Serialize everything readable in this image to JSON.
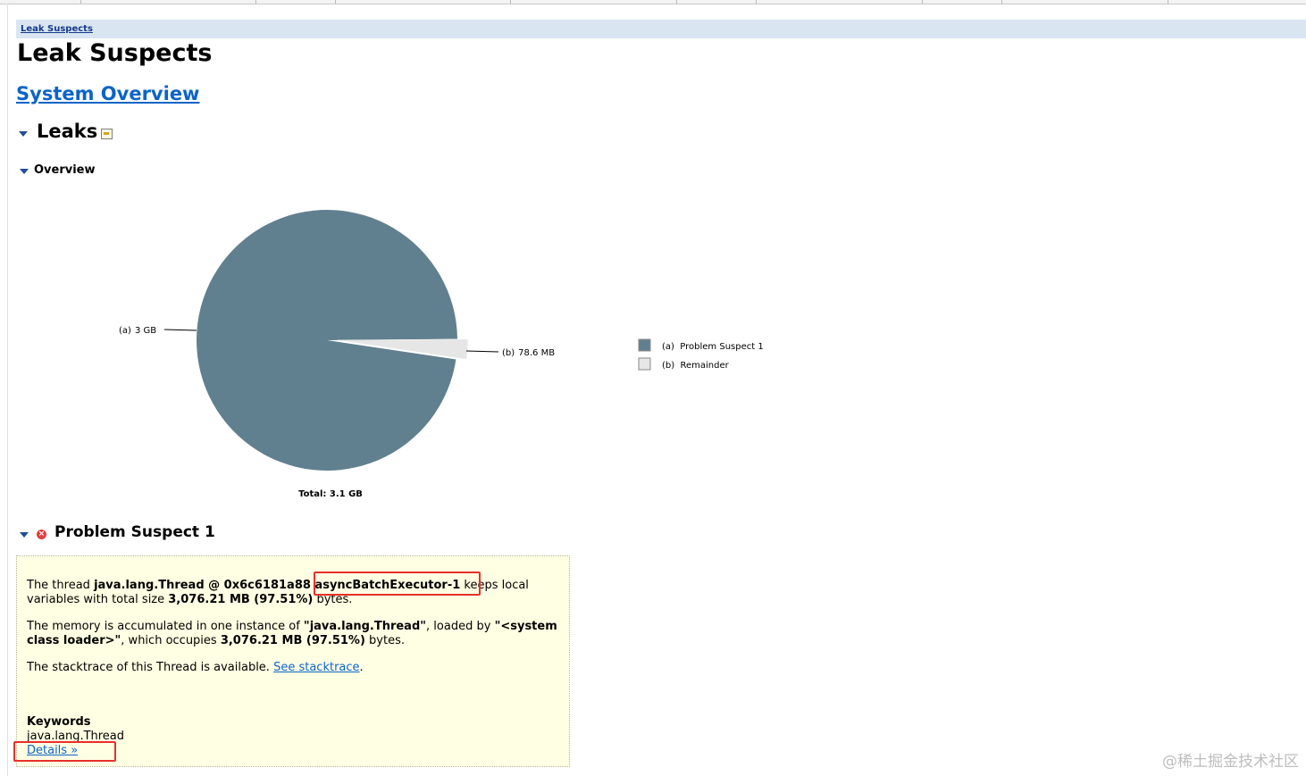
{
  "breadcrumb": {
    "label": "Leak Suspects"
  },
  "page_title": "Leak Suspects",
  "overview_link": "System Overview",
  "sections": {
    "leaks": "Leaks",
    "overview": "Overview",
    "problem_suspect": "Problem Suspect 1"
  },
  "chart_data": {
    "type": "pie",
    "slices": [
      {
        "label": "(a)",
        "value_label": "3 GB",
        "value_mb": 3076.21,
        "percent": 97.51,
        "legend": "(a)  Problem Suspect 1",
        "color": "#61808f"
      },
      {
        "label": "(b)",
        "value_label": "78.6 MB",
        "value_mb": 78.6,
        "percent": 2.49,
        "legend": "(b)  Remainder",
        "color": "#e6e6e6"
      }
    ],
    "total": "Total: 3.1 GB"
  },
  "suspect": {
    "p1": {
      "text1": "The thread ",
      "thread": "java.lang.Thread @ 0x6c6181a88 asyncBatchExecutor-1",
      "text2": " keeps local variables with total size ",
      "size": "3,076.21 MB (97.51%)",
      "text3": " bytes."
    },
    "p2": {
      "text1": "The memory is accumulated in one instance of ",
      "class": "\"java.lang.Thread\"",
      "text2": ", loaded by ",
      "loader": "\"<system class loader>\"",
      "text3": ", which occupies ",
      "size": "3,076.21 MB (97.51%)",
      "text4": " bytes."
    },
    "p3": {
      "text1": "The stacktrace of this Thread is available. ",
      "link": "See stacktrace",
      "text2": "."
    },
    "keywords_label": "Keywords",
    "keywords_value": "java.lang.Thread",
    "details_link": "Details »"
  },
  "watermark": "@稀土掘金技术社区"
}
